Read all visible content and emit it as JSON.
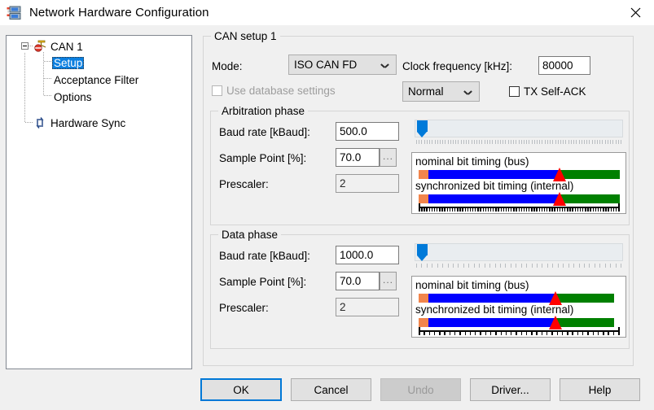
{
  "window": {
    "title": "Network Hardware Configuration",
    "icon": "network-hardware-icon",
    "close_label": "✕"
  },
  "tree": {
    "nodes": [
      {
        "label": "CAN 1",
        "icon": "can-channel-icon",
        "expanded": true,
        "selected": false
      },
      {
        "label": "Setup",
        "icon": "",
        "selected": true
      },
      {
        "label": "Acceptance Filter",
        "icon": "",
        "selected": false
      },
      {
        "label": "Options",
        "icon": "",
        "selected": false
      },
      {
        "label": "Hardware Sync",
        "icon": "hardware-sync-icon",
        "selected": false
      }
    ]
  },
  "can_setup": {
    "group_title": "CAN setup 1",
    "mode_label": "Mode:",
    "mode_value": "ISO CAN FD",
    "use_database_label": "Use database settings",
    "use_database_checked": false,
    "use_database_enabled": false,
    "clock_label": "Clock frequency [kHz]:",
    "clock_value": "80000",
    "transceiver_value": "Normal",
    "tx_self_ack_label": "TX Self-ACK",
    "tx_self_ack_checked": false
  },
  "arbitration": {
    "group_title": "Arbitration phase",
    "baud_label": "Baud rate [kBaud]:",
    "baud_value": "500.0",
    "sample_label": "Sample Point [%]:",
    "sample_value": "70.0",
    "sample_browse_label": "...",
    "prescaler_label": "Prescaler:",
    "prescaler_value": "2",
    "slider_position_pct": 1,
    "slider_tick_count": 78,
    "bit_timing": {
      "nominal_caption": "nominal bit timing (bus)",
      "sync_caption": "synchronized bit timing (internal)",
      "sync_pct": 5,
      "prop_pct": 65,
      "phase2_pct": 30,
      "sample_point_pct": 70,
      "ruler_tick_count": 78
    }
  },
  "data_phase": {
    "group_title": "Data phase",
    "baud_label": "Baud rate [kBaud]:",
    "baud_value": "1000.0",
    "sample_label": "Sample Point [%]:",
    "sample_value": "70.0",
    "sample_browse_label": "...",
    "prescaler_label": "Prescaler:",
    "prescaler_value": "2",
    "slider_position_pct": 1,
    "slider_tick_count": 39,
    "bit_timing": {
      "nominal_caption": "nominal bit timing (bus)",
      "sync_caption": "synchronized bit timing (internal)",
      "sync_pct": 5,
      "prop_pct": 65,
      "phase2_pct": 30,
      "sample_point_pct": 70,
      "ruler_tick_count": 39
    }
  },
  "footer": {
    "ok": "OK",
    "cancel": "Cancel",
    "undo": "Undo",
    "driver": "Driver...",
    "help": "Help"
  },
  "colors": {
    "accent": "#0078d7",
    "selection": "#0a7fe0",
    "sync_segment": "#f2854c",
    "prop_segment": "#0000ff",
    "phase2_segment": "#008000",
    "sample_marker": "#ff0000",
    "slider_thumb": "#007ad9"
  }
}
